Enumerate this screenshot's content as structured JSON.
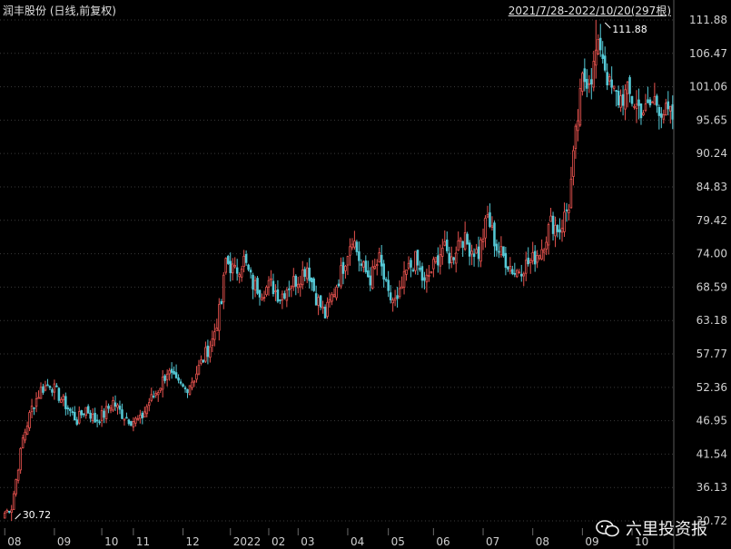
{
  "header": {
    "title": "润丰股份 (日线,前复权)",
    "range": "2021/7/28-2022/10/20(297根)"
  },
  "watermark": {
    "text": "六里投资报",
    "icon": "wechat-icon"
  },
  "colors": {
    "up": "#e8534f",
    "down": "#55c9d6",
    "grid": "#3a3a3a",
    "background": "#000000"
  },
  "chart_data": {
    "type": "candlestick",
    "title": "",
    "xlabel": "",
    "ylabel": "",
    "ylim": [
      30.72,
      111.88
    ],
    "y_ticks": [
      "111.88",
      "106.47",
      "101.06",
      "95.65",
      "90.24",
      "84.83",
      "79.42",
      "74.00",
      "68.59",
      "63.18",
      "57.77",
      "52.36",
      "46.95",
      "41.54",
      "36.13",
      "30.72"
    ],
    "x_ticks": [
      {
        "label": "08",
        "index": 0
      },
      {
        "label": "09",
        "index": 22
      },
      {
        "label": "10",
        "index": 43
      },
      {
        "label": "11",
        "index": 57
      },
      {
        "label": "12",
        "index": 79
      },
      {
        "label": "2022",
        "index": 100
      },
      {
        "label": "02",
        "index": 117
      },
      {
        "label": "03",
        "index": 130
      },
      {
        "label": "04",
        "index": 152
      },
      {
        "label": "05",
        "index": 170
      },
      {
        "label": "06",
        "index": 190
      },
      {
        "label": "07",
        "index": 212
      },
      {
        "label": "08",
        "index": 234
      },
      {
        "label": "09",
        "index": 256
      },
      {
        "label": "10",
        "index": 278
      }
    ],
    "grid": "horizontal",
    "annotations": [
      {
        "text": "30.72",
        "index": 3,
        "value": 30.72,
        "kind": "low"
      },
      {
        "text": "111.88",
        "index": 262,
        "value": 111.88,
        "kind": "high"
      }
    ],
    "n_bars": 297,
    "close_path": [
      [
        0,
        32
      ],
      [
        3,
        33
      ],
      [
        8,
        44
      ],
      [
        12,
        49
      ],
      [
        16,
        52
      ],
      [
        20,
        53
      ],
      [
        24,
        51
      ],
      [
        28,
        49
      ],
      [
        32,
        47
      ],
      [
        36,
        49
      ],
      [
        40,
        47
      ],
      [
        44,
        48
      ],
      [
        48,
        50
      ],
      [
        52,
        48
      ],
      [
        56,
        47
      ],
      [
        60,
        47
      ],
      [
        64,
        50
      ],
      [
        68,
        52
      ],
      [
        72,
        55
      ],
      [
        76,
        53
      ],
      [
        80,
        52
      ],
      [
        84,
        54
      ],
      [
        88,
        57
      ],
      [
        92,
        60
      ],
      [
        96,
        66
      ],
      [
        98,
        73
      ],
      [
        102,
        71
      ],
      [
        106,
        73
      ],
      [
        110,
        69
      ],
      [
        114,
        68
      ],
      [
        118,
        69
      ],
      [
        122,
        67
      ],
      [
        126,
        69
      ],
      [
        130,
        70
      ],
      [
        134,
        72
      ],
      [
        138,
        67
      ],
      [
        142,
        64
      ],
      [
        146,
        68
      ],
      [
        150,
        72
      ],
      [
        154,
        77
      ],
      [
        158,
        72
      ],
      [
        162,
        70
      ],
      [
        166,
        73
      ],
      [
        170,
        67
      ],
      [
        174,
        66
      ],
      [
        178,
        71
      ],
      [
        182,
        73
      ],
      [
        186,
        69
      ],
      [
        190,
        72
      ],
      [
        194,
        75
      ],
      [
        198,
        73
      ],
      [
        202,
        77
      ],
      [
        206,
        75
      ],
      [
        210,
        74
      ],
      [
        214,
        80
      ],
      [
        218,
        75
      ],
      [
        222,
        73
      ],
      [
        226,
        71
      ],
      [
        230,
        72
      ],
      [
        234,
        73
      ],
      [
        238,
        75
      ],
      [
        242,
        79
      ],
      [
        246,
        78
      ],
      [
        250,
        82
      ],
      [
        253,
        93
      ],
      [
        256,
        102
      ],
      [
        260,
        103
      ],
      [
        264,
        108
      ],
      [
        268,
        101
      ],
      [
        272,
        99
      ],
      [
        276,
        100
      ],
      [
        280,
        98
      ],
      [
        284,
        97
      ],
      [
        288,
        99
      ],
      [
        292,
        97
      ],
      [
        296,
        96
      ]
    ]
  }
}
